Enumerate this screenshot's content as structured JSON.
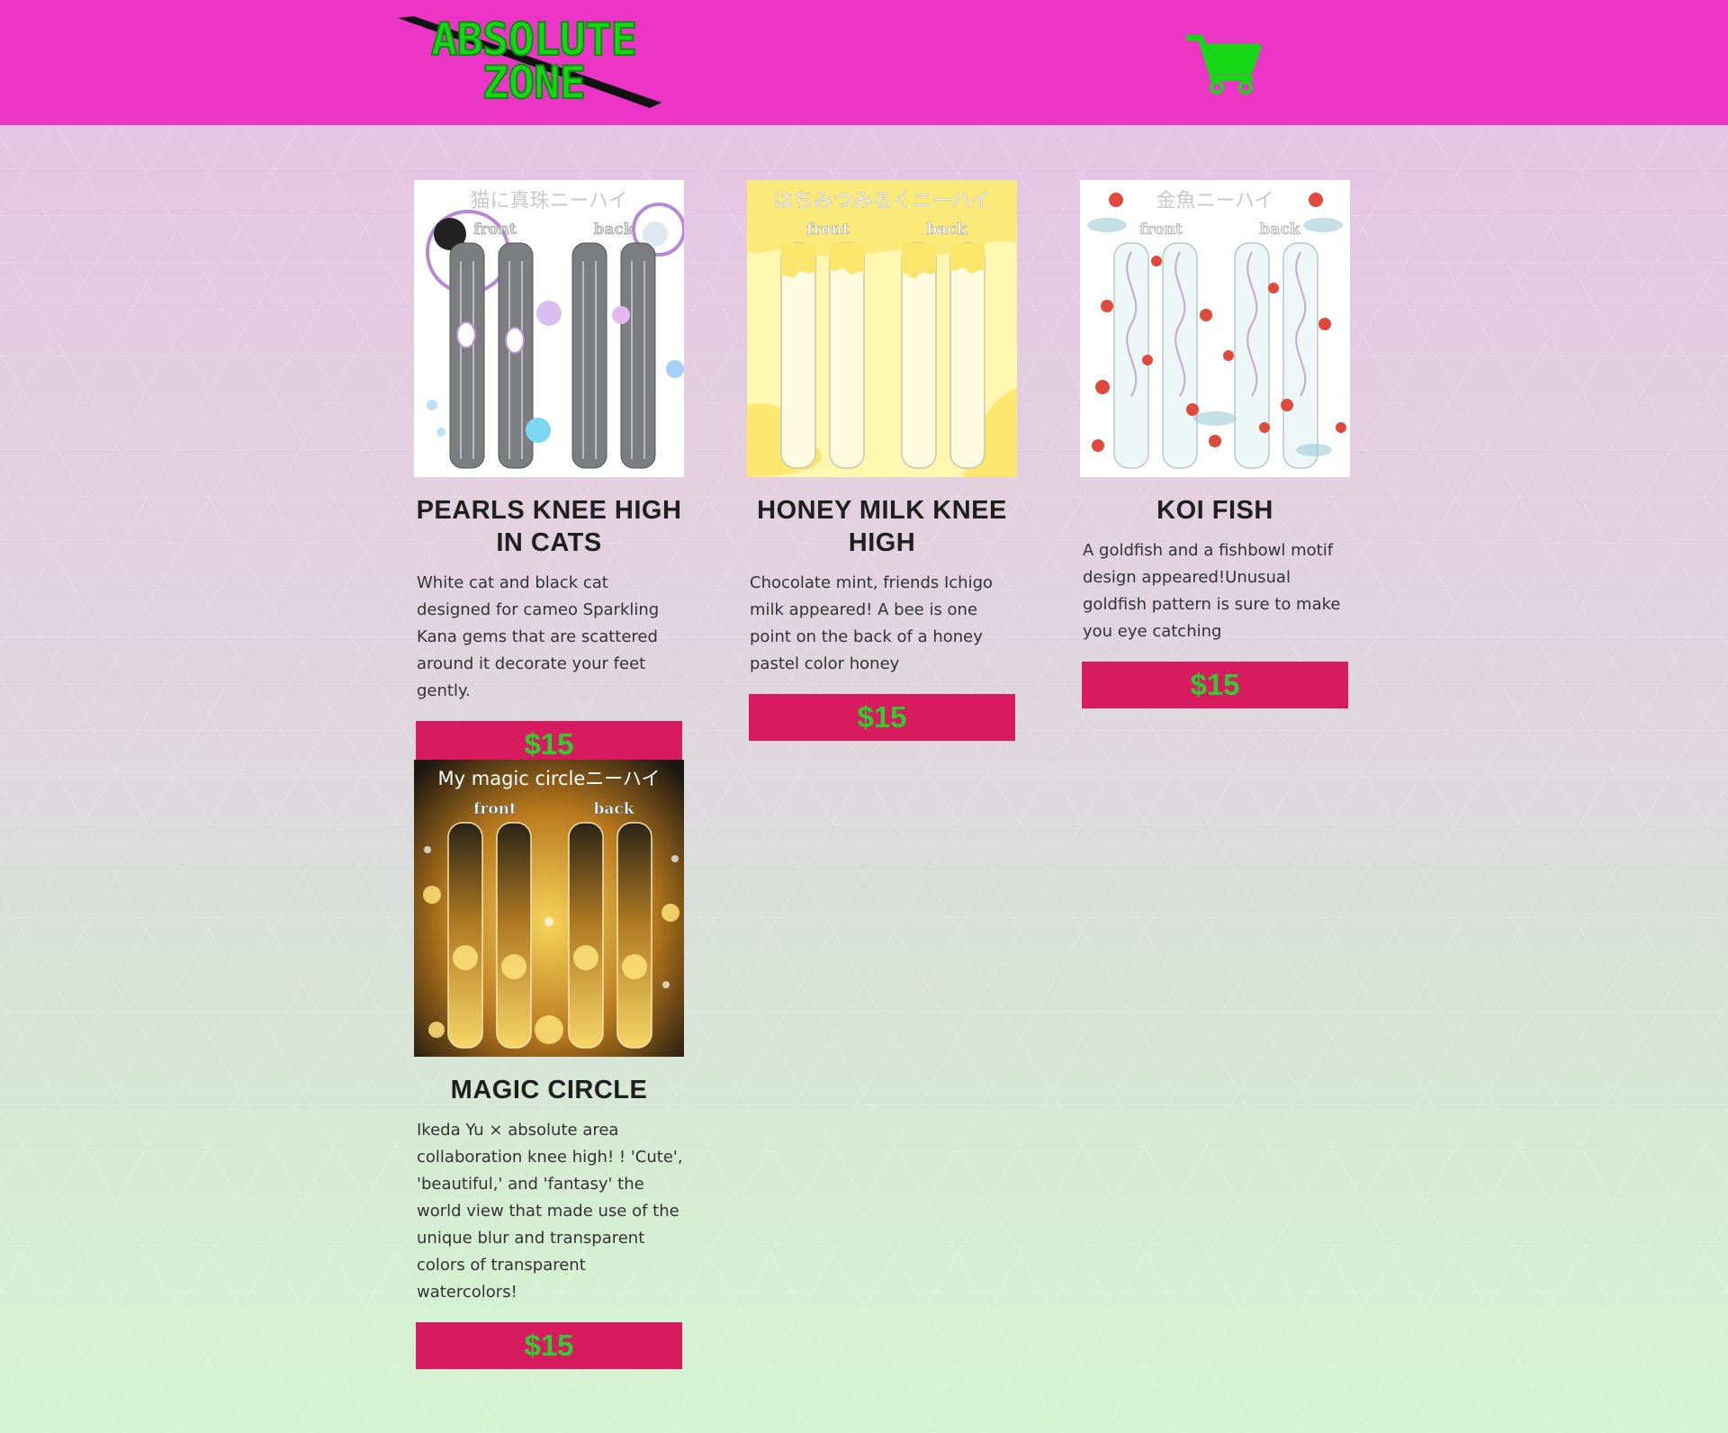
{
  "header": {
    "logo_line1": "ABSOLUTE",
    "logo_line2": "ZONE",
    "background_color": "#ec34c6",
    "cart_icon": "shopping-cart-icon",
    "accent_color": "#17d617"
  },
  "products": [
    {
      "title": "PEARLS KNEE HIGH IN CATS",
      "image_caption": "猫に真珠ニーハイ",
      "front_label": "front",
      "back_label": "back",
      "description": "White cat and black cat designed for cameo Sparkling Kana gems that are scattered around it decorate your feet gently.",
      "price": "$15"
    },
    {
      "title": "HONEY MILK KNEE HIGH",
      "image_caption": "はちみつみるくニーハイ",
      "front_label": "front",
      "back_label": "back",
      "description": "Chocolate mint, friends Ichigo milk appeared! A bee is one point on the back of a honey pastel color honey",
      "price": "$15"
    },
    {
      "title": "KOI FISH",
      "image_caption": "金魚ニーハイ",
      "front_label": "front",
      "back_label": "back",
      "description": "A goldfish and a fishbowl motif design appeared!Unusual goldfish pattern is sure to make you eye catching",
      "price": "$15"
    },
    {
      "title": "MAGIC CIRCLE",
      "image_caption": "My magic circleニーハイ",
      "front_label": "front",
      "back_label": "back",
      "description": "Ikeda Yu × absolute area collaboration knee high! ! 'Cute', 'beautiful,' and 'fantasy' the world view that made use of the unique blur and transparent colors of transparent watercolors!",
      "price": "$15"
    }
  ],
  "colors": {
    "price_button_bg": "#d81b5e",
    "price_text": "#2fcd2f"
  }
}
